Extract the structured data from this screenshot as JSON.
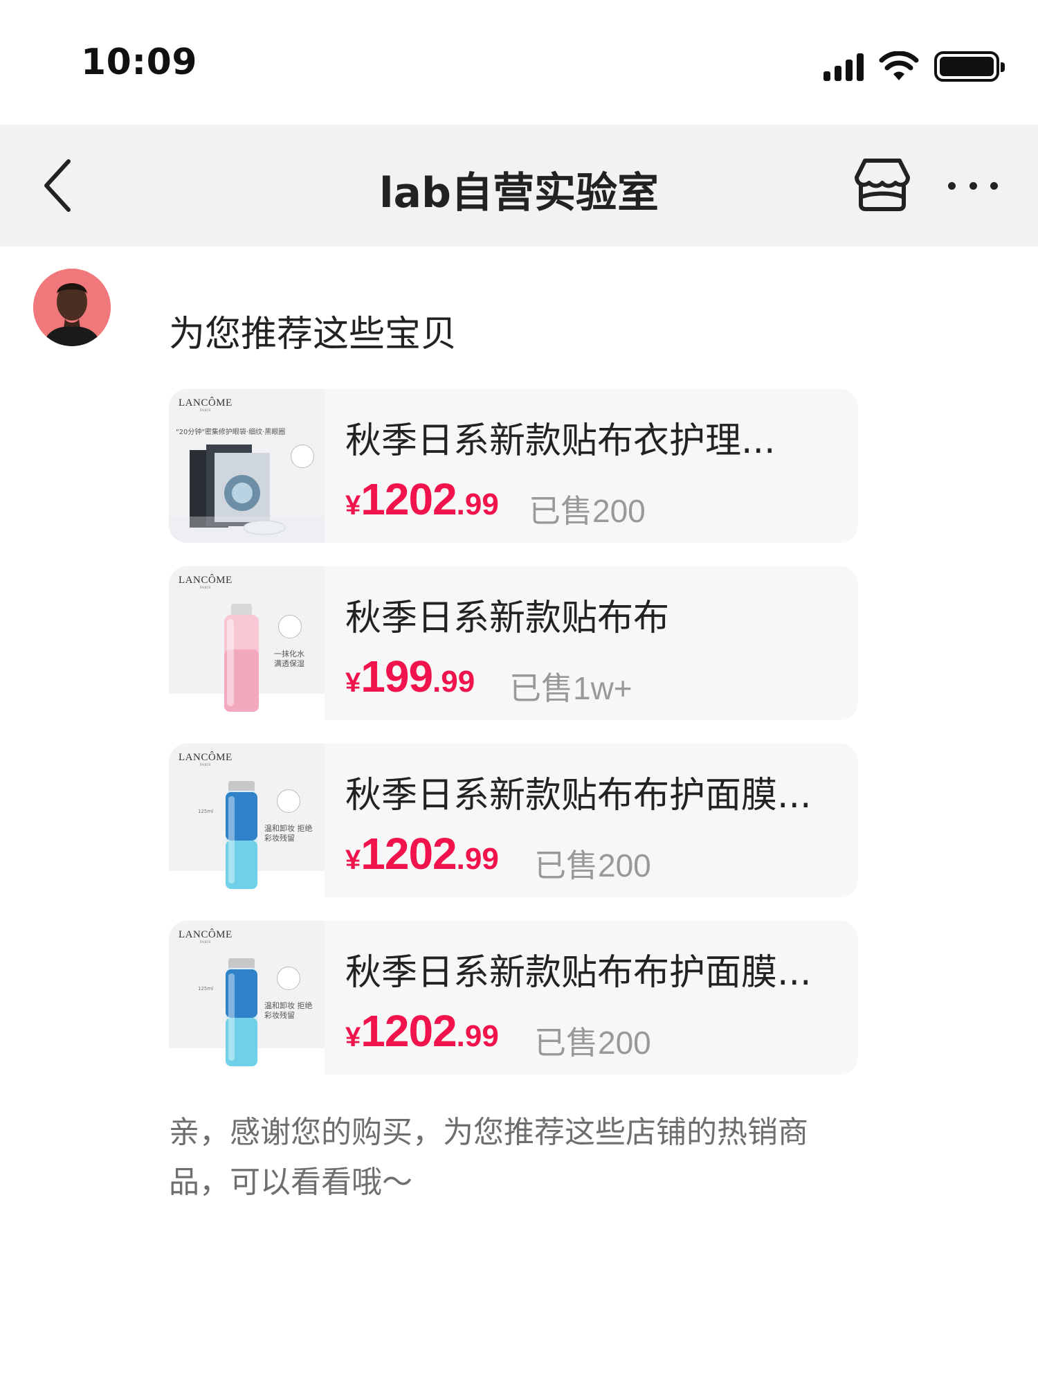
{
  "status_bar": {
    "time": "10:09",
    "icons": [
      "signal-icon",
      "wifi-icon",
      "battery-icon"
    ]
  },
  "nav": {
    "back_icon": "chevron-left-icon",
    "title": "lab自营实验室",
    "shop_icon": "store-icon",
    "more_icon": "ellipsis-icon"
  },
  "chat": {
    "intro": "为您推荐这些宝贝",
    "products": [
      {
        "name": "秋季日系新款贴布衣护理...",
        "currency": "¥",
        "price_int": "1202",
        "price_dec": ".99",
        "sold": "已售200",
        "image": "lancome-eye-mask",
        "brand": "LANCÔME",
        "image_caption": "\"20分钟\"密集修护眼袋·细纹·黑眼圈"
      },
      {
        "name": "秋季日系新款贴布布",
        "currency": "¥",
        "price_int": "199",
        "price_dec": ".99",
        "sold": "已售1w+",
        "image": "lancome-pink-toner",
        "brand": "LANCÔME",
        "image_caption": "一抹化水 满透保湿"
      },
      {
        "name": "秋季日系新款贴布布护面膜...",
        "currency": "¥",
        "price_int": "1202",
        "price_dec": ".99",
        "sold": "已售200",
        "image": "lancome-makeup-remover",
        "brand": "LANCÔME",
        "image_caption": "温和卸妆 拒绝彩妆残留"
      },
      {
        "name": "秋季日系新款贴布布护面膜...",
        "currency": "¥",
        "price_int": "1202",
        "price_dec": ".99",
        "sold": "已售200",
        "image": "lancome-makeup-remover",
        "brand": "LANCÔME",
        "image_caption": "温和卸妆 拒绝彩妆残留"
      }
    ],
    "footer_message": "亲，感谢您的购买，为您推荐这些店铺的热销商品，可以看看哦～"
  },
  "colors": {
    "price": "#f0134c",
    "nav_bg": "#f2f2f2",
    "card_bg": "#f7f7f7",
    "muted_text": "#999999",
    "avatar_bg": "#f0787a"
  }
}
